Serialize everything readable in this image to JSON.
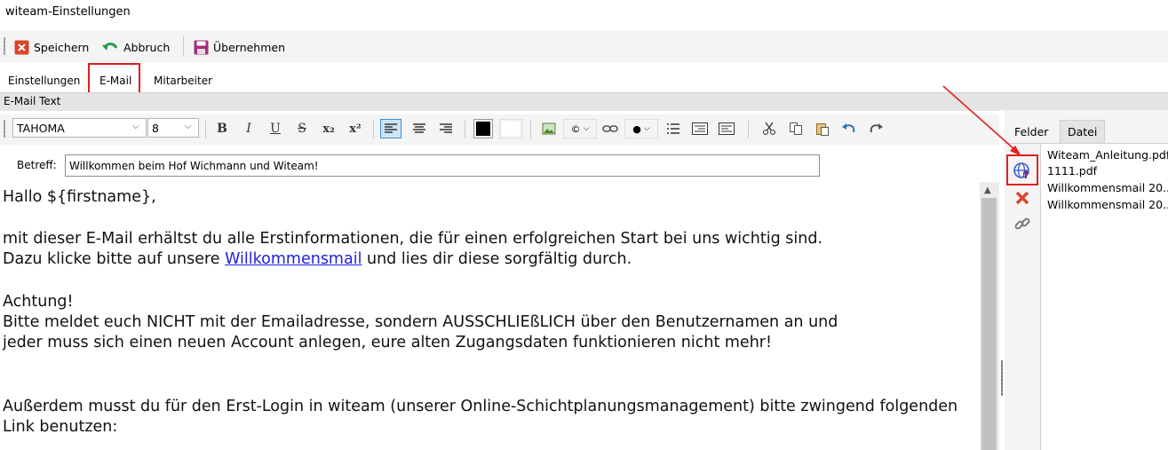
{
  "window": {
    "title": "witeam-Einstellungen"
  },
  "toolbar": {
    "save_label": "Speichern",
    "cancel_label": "Abbruch",
    "apply_label": "Übernehmen"
  },
  "tabs": [
    {
      "label": "Einstellungen"
    },
    {
      "label": "E-Mail",
      "selected": true
    },
    {
      "label": "Mitarbeiter"
    }
  ],
  "section": {
    "title": "E-Mail Text"
  },
  "format": {
    "font_name": "TAHOMA",
    "font_size": "8",
    "bold": "B",
    "italic": "I",
    "underline": "U",
    "strike": "S",
    "subscript": "x₂",
    "superscript": "x²",
    "foreground_color": "#000000",
    "background_color": "#ffffff"
  },
  "subject": {
    "label": "Betreff:",
    "value": "Willkommen beim Hof Wichmann und Witeam!"
  },
  "body": {
    "greeting": "Hallo ${firstname},",
    "line1": "mit dieser E-Mail erhältst du alle Erstinformationen, die für einen erfolgreichen Start bei uns wichtig sind.",
    "line2_before": "Dazu klicke bitte auf unsere ",
    "line2_link": "Willkommensmail",
    "line2_after": " und lies dir diese sorgfältig durch.",
    "attention": "Achtung!",
    "line3": "Bitte meldet euch NICHT mit der Emailadresse, sondern AUSSCHLIEßLICH über den Benutzernamen an und",
    "line4": "jeder muss sich einen neuen Account anlegen, eure alten Zugangsdaten funktionieren nicht mehr!",
    "line5": "Außerdem musst du für den Erst-Login in witeam (unserer Online-Schichtplanungsmanagement) bitte zwingend folgenden",
    "line6": "Link benutzen:"
  },
  "side_tabs": [
    {
      "label": "Felder"
    },
    {
      "label": "Datei",
      "selected": true
    }
  ],
  "side_icons": [
    "upload-globe-icon",
    "delete-icon",
    "link-icon"
  ],
  "files": [
    "Witeam_Anleitung.pdf",
    "1111.pdf",
    "Willkommensmail 20...",
    "Willkommensmail 20..."
  ],
  "colors": {
    "highlight_box": "#e02020",
    "link": "#1f1fe0",
    "active_button": "#cce4f7"
  }
}
